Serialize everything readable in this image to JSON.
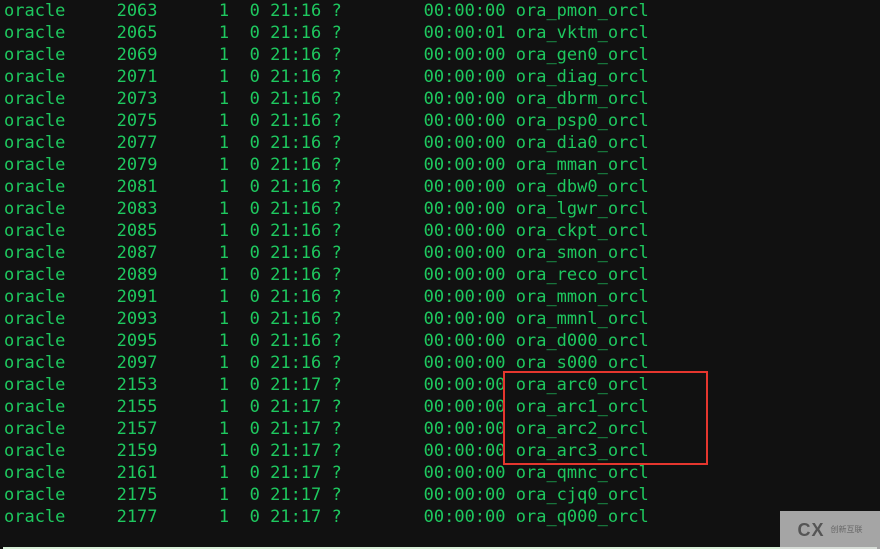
{
  "rows": [
    {
      "user": "oracle",
      "pid": "2063",
      "ppid": "1",
      "c": "0",
      "stime": "21:16",
      "tty": "?",
      "time": "00:00:00",
      "cmd": "ora_pmon_orcl"
    },
    {
      "user": "oracle",
      "pid": "2065",
      "ppid": "1",
      "c": "0",
      "stime": "21:16",
      "tty": "?",
      "time": "00:00:01",
      "cmd": "ora_vktm_orcl"
    },
    {
      "user": "oracle",
      "pid": "2069",
      "ppid": "1",
      "c": "0",
      "stime": "21:16",
      "tty": "?",
      "time": "00:00:00",
      "cmd": "ora_gen0_orcl"
    },
    {
      "user": "oracle",
      "pid": "2071",
      "ppid": "1",
      "c": "0",
      "stime": "21:16",
      "tty": "?",
      "time": "00:00:00",
      "cmd": "ora_diag_orcl"
    },
    {
      "user": "oracle",
      "pid": "2073",
      "ppid": "1",
      "c": "0",
      "stime": "21:16",
      "tty": "?",
      "time": "00:00:00",
      "cmd": "ora_dbrm_orcl"
    },
    {
      "user": "oracle",
      "pid": "2075",
      "ppid": "1",
      "c": "0",
      "stime": "21:16",
      "tty": "?",
      "time": "00:00:00",
      "cmd": "ora_psp0_orcl"
    },
    {
      "user": "oracle",
      "pid": "2077",
      "ppid": "1",
      "c": "0",
      "stime": "21:16",
      "tty": "?",
      "time": "00:00:00",
      "cmd": "ora_dia0_orcl"
    },
    {
      "user": "oracle",
      "pid": "2079",
      "ppid": "1",
      "c": "0",
      "stime": "21:16",
      "tty": "?",
      "time": "00:00:00",
      "cmd": "ora_mman_orcl"
    },
    {
      "user": "oracle",
      "pid": "2081",
      "ppid": "1",
      "c": "0",
      "stime": "21:16",
      "tty": "?",
      "time": "00:00:00",
      "cmd": "ora_dbw0_orcl"
    },
    {
      "user": "oracle",
      "pid": "2083",
      "ppid": "1",
      "c": "0",
      "stime": "21:16",
      "tty": "?",
      "time": "00:00:00",
      "cmd": "ora_lgwr_orcl"
    },
    {
      "user": "oracle",
      "pid": "2085",
      "ppid": "1",
      "c": "0",
      "stime": "21:16",
      "tty": "?",
      "time": "00:00:00",
      "cmd": "ora_ckpt_orcl"
    },
    {
      "user": "oracle",
      "pid": "2087",
      "ppid": "1",
      "c": "0",
      "stime": "21:16",
      "tty": "?",
      "time": "00:00:00",
      "cmd": "ora_smon_orcl"
    },
    {
      "user": "oracle",
      "pid": "2089",
      "ppid": "1",
      "c": "0",
      "stime": "21:16",
      "tty": "?",
      "time": "00:00:00",
      "cmd": "ora_reco_orcl"
    },
    {
      "user": "oracle",
      "pid": "2091",
      "ppid": "1",
      "c": "0",
      "stime": "21:16",
      "tty": "?",
      "time": "00:00:00",
      "cmd": "ora_mmon_orcl"
    },
    {
      "user": "oracle",
      "pid": "2093",
      "ppid": "1",
      "c": "0",
      "stime": "21:16",
      "tty": "?",
      "time": "00:00:00",
      "cmd": "ora_mmnl_orcl"
    },
    {
      "user": "oracle",
      "pid": "2095",
      "ppid": "1",
      "c": "0",
      "stime": "21:16",
      "tty": "?",
      "time": "00:00:00",
      "cmd": "ora_d000_orcl"
    },
    {
      "user": "oracle",
      "pid": "2097",
      "ppid": "1",
      "c": "0",
      "stime": "21:16",
      "tty": "?",
      "time": "00:00:00",
      "cmd": "ora_s000_orcl"
    },
    {
      "user": "oracle",
      "pid": "2153",
      "ppid": "1",
      "c": "0",
      "stime": "21:17",
      "tty": "?",
      "time": "00:00:00",
      "cmd": "ora_arc0_orcl"
    },
    {
      "user": "oracle",
      "pid": "2155",
      "ppid": "1",
      "c": "0",
      "stime": "21:17",
      "tty": "?",
      "time": "00:00:00",
      "cmd": "ora_arc1_orcl"
    },
    {
      "user": "oracle",
      "pid": "2157",
      "ppid": "1",
      "c": "0",
      "stime": "21:17",
      "tty": "?",
      "time": "00:00:00",
      "cmd": "ora_arc2_orcl"
    },
    {
      "user": "oracle",
      "pid": "2159",
      "ppid": "1",
      "c": "0",
      "stime": "21:17",
      "tty": "?",
      "time": "00:00:00",
      "cmd": "ora_arc3_orcl"
    },
    {
      "user": "oracle",
      "pid": "2161",
      "ppid": "1",
      "c": "0",
      "stime": "21:17",
      "tty": "?",
      "time": "00:00:00",
      "cmd": "ora_qmnc_orcl"
    },
    {
      "user": "oracle",
      "pid": "2175",
      "ppid": "1",
      "c": "0",
      "stime": "21:17",
      "tty": "?",
      "time": "00:00:00",
      "cmd": "ora_cjq0_orcl"
    },
    {
      "user": "oracle",
      "pid": "2177",
      "ppid": "1",
      "c": "0",
      "stime": "21:17",
      "tty": "?",
      "time": "00:00:00",
      "cmd": "ora_q000_orcl"
    }
  ],
  "highlight": {
    "start_row_index": 17,
    "end_row_index": 20,
    "contains_cmds": [
      "ora_arc0_orcl",
      "ora_arc1_orcl",
      "ora_arc2_orcl",
      "ora_arc3_orcl"
    ]
  },
  "watermark": {
    "logo_text": "CX",
    "zh_text": "创新互联"
  }
}
